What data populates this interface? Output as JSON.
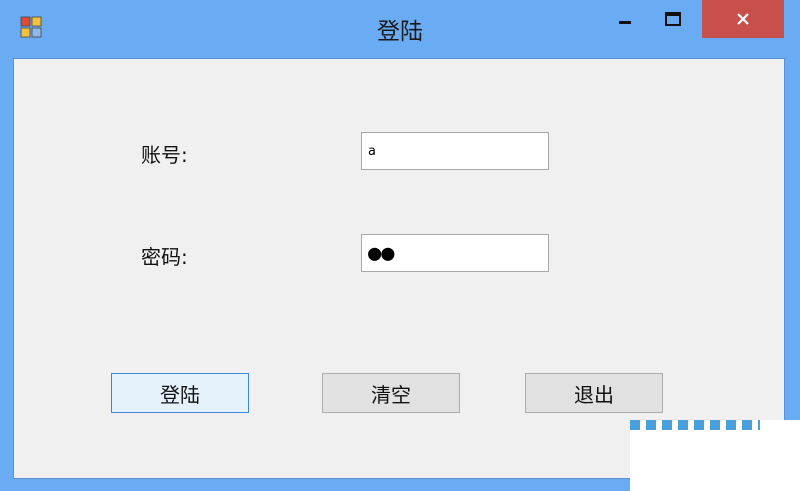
{
  "window": {
    "title": "登陆",
    "controls": {
      "minimize": "–",
      "maximize": "□",
      "close": "✕"
    },
    "icon": "app-window-icon"
  },
  "form": {
    "account": {
      "label": "账号:",
      "value": "a"
    },
    "password": {
      "label": "密码:",
      "value": "●●"
    }
  },
  "buttons": {
    "login": "登陆",
    "clear": "清空",
    "exit": "退出"
  },
  "colors": {
    "frame": "#6aacf3",
    "client": "#f0f0f0",
    "close": "#c7504d",
    "focus_border": "#3c86d8"
  }
}
